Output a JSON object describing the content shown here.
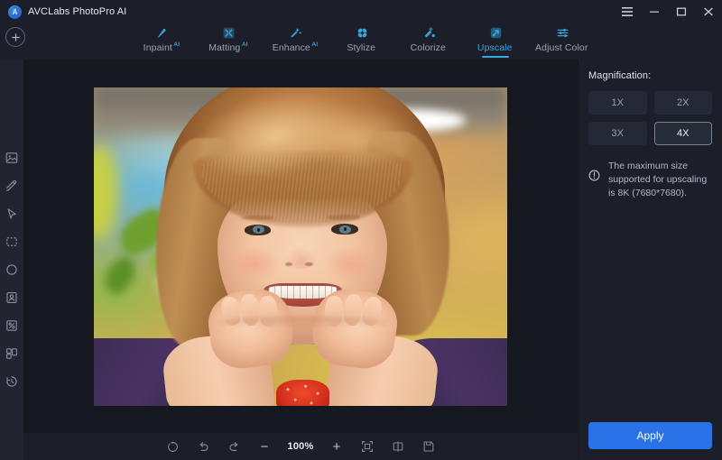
{
  "app": {
    "title": "AVCLabs PhotoPro AI",
    "logo_icon": "avclabs-logo-icon"
  },
  "window_controls": {
    "menu_icon": "hamburger-menu-icon",
    "minimize_icon": "minimize-icon",
    "maximize_icon": "maximize-icon",
    "close_icon": "close-icon"
  },
  "topnav": {
    "add_icon": "add-circle-icon",
    "tabs": [
      {
        "label": "Inpaint",
        "sup": "AI",
        "icon": "inpaint-icon",
        "active": false
      },
      {
        "label": "Matting",
        "sup": "AI",
        "icon": "matting-icon",
        "active": false
      },
      {
        "label": "Enhance",
        "sup": "AI",
        "icon": "enhance-icon",
        "active": false
      },
      {
        "label": "Stylize",
        "sup": "",
        "icon": "stylize-icon",
        "active": false
      },
      {
        "label": "Colorize",
        "sup": "",
        "icon": "colorize-icon",
        "active": false
      },
      {
        "label": "Upscale",
        "sup": "",
        "icon": "upscale-icon",
        "active": true
      },
      {
        "label": "Adjust Color",
        "sup": "",
        "icon": "adjust-color-icon",
        "active": false
      }
    ]
  },
  "toolrail": {
    "tools": [
      {
        "name": "image-tool",
        "icon": "image-icon"
      },
      {
        "name": "brush-tool",
        "icon": "brush-icon"
      },
      {
        "name": "pointer-tool",
        "icon": "cursor-pointer-icon"
      },
      {
        "name": "rectangle-tool",
        "icon": "rectangle-marquee-icon"
      },
      {
        "name": "ellipse-tool",
        "icon": "circle-icon"
      },
      {
        "name": "portrait-tool",
        "icon": "portrait-icon"
      },
      {
        "name": "effect-tool",
        "icon": "effect-icon"
      },
      {
        "name": "layers-tool",
        "icon": "layers-icon"
      },
      {
        "name": "history-tool",
        "icon": "history-clock-icon"
      }
    ]
  },
  "canvas": {
    "image_alt": "Smiling young girl with hands on cheeks, blurred greenhouse background"
  },
  "bottombar": {
    "reset_icon": "reset-icon",
    "undo_icon": "undo-icon",
    "redo_icon": "redo-icon",
    "zoom_out_label": "−",
    "zoom_level": "100%",
    "zoom_in_label": "+",
    "fit_icon": "fit-to-screen-icon",
    "compare_icon": "compare-split-icon",
    "save_icon": "save-icon"
  },
  "rightpanel": {
    "title": "Magnification:",
    "options": [
      {
        "label": "1X",
        "selected": false
      },
      {
        "label": "2X",
        "selected": false
      },
      {
        "label": "3X",
        "selected": false
      },
      {
        "label": "4X",
        "selected": true
      }
    ],
    "note_icon": "info-icon",
    "note": "The maximum size supported for upscaling is 8K (7680*7680).",
    "apply_label": "Apply"
  },
  "colors": {
    "accent_blue": "#2a72e8",
    "tab_active": "#36a6e0",
    "tab_icon": "#3a9fd4",
    "panel_bg": "#1c1f2a",
    "canvas_bg": "#16181f",
    "rail_bg": "#22252f"
  }
}
